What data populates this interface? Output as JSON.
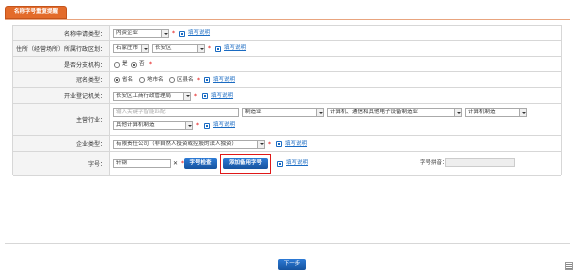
{
  "header": {
    "tab_label": "名称字号重复提醒"
  },
  "form": {
    "name_type": {
      "label": "名称申请类型：",
      "value": "内资企业",
      "help": "填写说明"
    },
    "region": {
      "label": "住所（经营场所）所属行政区划：",
      "city": "石家庄市",
      "district": "长安区",
      "help": "填写说明"
    },
    "branch": {
      "label": "是否分支机构：",
      "option_yes": "是",
      "option_no": "否",
      "selected": "否"
    },
    "prefix": {
      "label": "冠名类型：",
      "options": [
        "省名",
        "地市名",
        "区县名"
      ],
      "selected": "省名",
      "help": "填写说明"
    },
    "authority": {
      "label": "开业登记机关：",
      "value": "长安区工商行政管理局",
      "help": "填写说明"
    },
    "industry": {
      "label": "主营行业：",
      "search_placeholder": "输入关键字智能匹配",
      "level1": "制造业",
      "level2": "计算机、通信和其他电子设备制造业",
      "level3": "计算机制造",
      "level4": "其他计算机制造",
      "help": "填写说明"
    },
    "company_type": {
      "label": "企业类型：",
      "value": "有限责任公司（非自然人投资或控股的法人独资）",
      "help": "填写说明"
    },
    "trade_name": {
      "label": "字号：",
      "value": "轩钢",
      "check_button": "字号检查",
      "add_alt_button": "添加备用字号",
      "help": "填写说明",
      "pinyin_label": "字号拼音：",
      "pinyin_value": ""
    }
  },
  "footer": {
    "next_button": "下一步"
  },
  "colors": {
    "accent_orange": "#e36b2a",
    "link_blue": "#1a6bc2",
    "button_blue": "#1f63b8",
    "required_red": "#e00000",
    "highlight_red": "#e01818"
  }
}
